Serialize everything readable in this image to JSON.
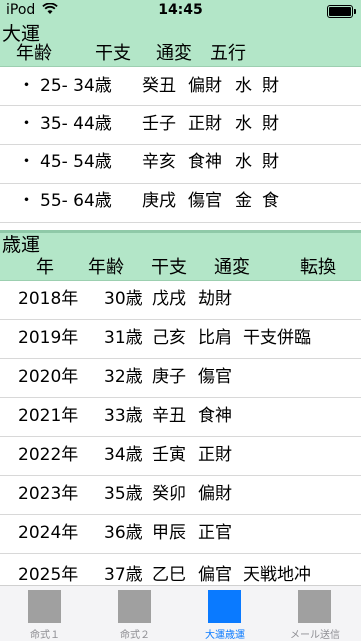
{
  "status": {
    "carrier": "iPod",
    "time": "14:45"
  },
  "taiun": {
    "title": "大運",
    "headers": [
      "年齢",
      "干支",
      "通変",
      "五行"
    ],
    "rows": [
      {
        "bullet": "・",
        "age": "25- 34歳",
        "kanshi": "癸丑",
        "tsuhen": "偏財",
        "gogyo1": "水",
        "gogyo2": "財"
      },
      {
        "bullet": "・",
        "age": "35- 44歳",
        "kanshi": "壬子",
        "tsuhen": "正財",
        "gogyo1": "水",
        "gogyo2": "財"
      },
      {
        "bullet": "・",
        "age": "45- 54歳",
        "kanshi": "辛亥",
        "tsuhen": "食神",
        "gogyo1": "水",
        "gogyo2": "財"
      },
      {
        "bullet": "・",
        "age": "55- 64歳",
        "kanshi": "庚戌",
        "tsuhen": "傷官",
        "gogyo1": "金",
        "gogyo2": "食"
      }
    ]
  },
  "saiun": {
    "title": "歳運",
    "headers": [
      "年",
      "年齢",
      "干支",
      "通変",
      "転換"
    ],
    "rows": [
      {
        "year": "2018年",
        "age": "30歳",
        "kanshi": "戊戌",
        "tsuhen": "劫財",
        "tenkan": ""
      },
      {
        "year": "2019年",
        "age": "31歳",
        "kanshi": "己亥",
        "tsuhen": "比肩",
        "tenkan": "干支併臨"
      },
      {
        "year": "2020年",
        "age": "32歳",
        "kanshi": "庚子",
        "tsuhen": "傷官",
        "tenkan": ""
      },
      {
        "year": "2021年",
        "age": "33歳",
        "kanshi": "辛丑",
        "tsuhen": "食神",
        "tenkan": ""
      },
      {
        "year": "2022年",
        "age": "34歳",
        "kanshi": "壬寅",
        "tsuhen": "正財",
        "tenkan": ""
      },
      {
        "year": "2023年",
        "age": "35歳",
        "kanshi": "癸卯",
        "tsuhen": "偏財",
        "tenkan": ""
      },
      {
        "year": "2024年",
        "age": "36歳",
        "kanshi": "甲辰",
        "tsuhen": "正官",
        "tenkan": ""
      },
      {
        "year": "2025年",
        "age": "37歳",
        "kanshi": "乙巳",
        "tsuhen": "偏官",
        "tenkan": "天戦地冲"
      }
    ]
  },
  "tabs": [
    {
      "label": "命式１",
      "active": false
    },
    {
      "label": "命式２",
      "active": false
    },
    {
      "label": "大運歳運",
      "active": true
    },
    {
      "label": "メール送信",
      "active": false
    }
  ],
  "colors": {
    "header_bg": "#b3e6c8",
    "active_tab": "#0a7aff",
    "inactive_icon": "#a0a0a0"
  }
}
